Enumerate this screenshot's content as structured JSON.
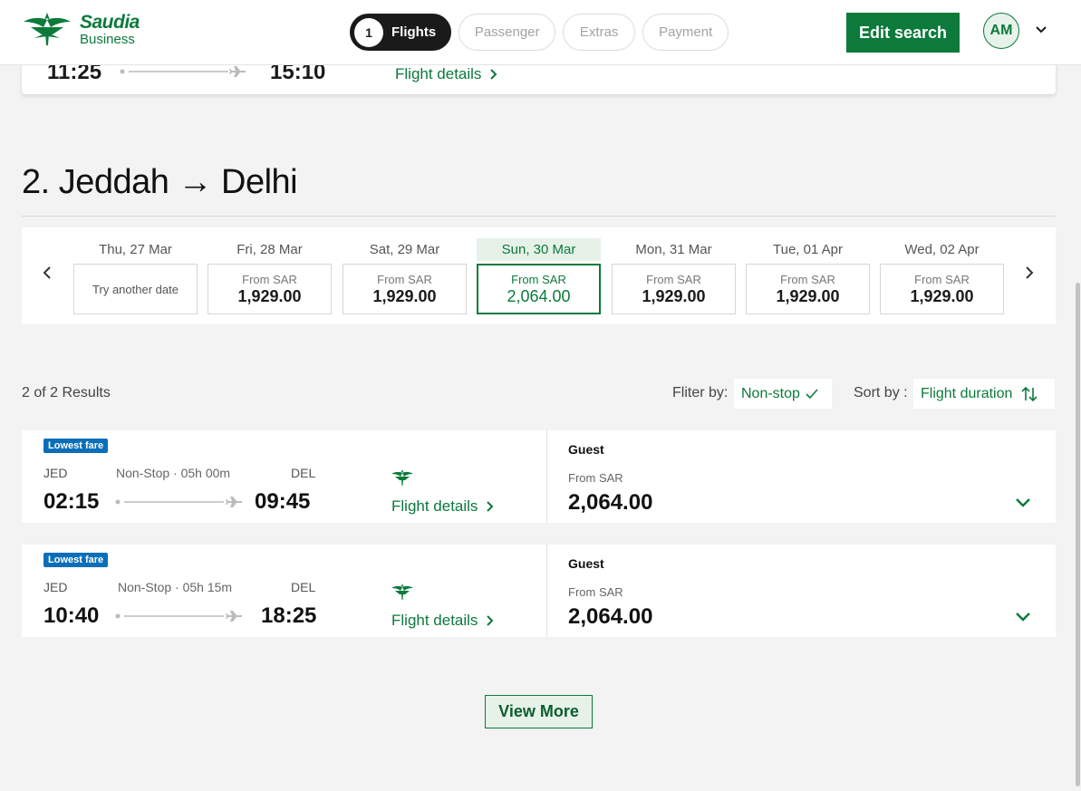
{
  "header": {
    "logo_brand": "Saudia",
    "logo_sub": "Business",
    "steps": [
      {
        "num": "1",
        "label": "Flights"
      },
      {
        "label": "Passenger"
      },
      {
        "label": "Extras"
      },
      {
        "label": "Payment"
      }
    ],
    "edit_search": "Edit search",
    "avatar_initials": "AM"
  },
  "prev_flight": {
    "depart": "11:25",
    "arrive": "15:10",
    "details": "Flight details"
  },
  "section": {
    "title": "2. Jeddah → Delhi"
  },
  "date_strip": {
    "days": [
      {
        "label": "Thu, 27 Mar",
        "other": "Try another date"
      },
      {
        "label": "Fri, 28 Mar",
        "from": "From SAR",
        "price": "1,929.00"
      },
      {
        "label": "Sat, 29 Mar",
        "from": "From SAR",
        "price": "1,929.00"
      },
      {
        "label": "Sun, 30 Mar",
        "from": "From SAR",
        "price": "2,064.00",
        "selected": true
      },
      {
        "label": "Mon, 31 Mar",
        "from": "From SAR",
        "price": "1,929.00"
      },
      {
        "label": "Tue, 01 Apr",
        "from": "From SAR",
        "price": "1,929.00"
      },
      {
        "label": "Wed, 02 Apr",
        "from": "From SAR",
        "price": "1,929.00"
      }
    ]
  },
  "results": {
    "count": "2 of 2 Results",
    "filter_label": "Fliter by:",
    "filter_value": "Non-stop",
    "sort_label": "Sort by :",
    "sort_value": "Flight duration"
  },
  "flights": [
    {
      "badge": "Lowest fare",
      "origin": "JED",
      "duration": "Non-Stop · 05h 00m",
      "destination": "DEL",
      "depart": "02:15",
      "arrive": "09:45",
      "details": "Flight details",
      "guest": "Guest",
      "from": "From SAR",
      "fare": "2,064.00"
    },
    {
      "badge": "Lowest fare",
      "origin": "JED",
      "duration": "Non-Stop · 05h 15m",
      "destination": "DEL",
      "depart": "10:40",
      "arrive": "18:25",
      "details": "Flight details",
      "guest": "Guest",
      "from": "From SAR",
      "fare": "2,064.00"
    }
  ],
  "view_more": "View More",
  "colors": {
    "brand": "#0b7a3b",
    "badge": "#0a6fb8",
    "background": "#f3f3f3"
  }
}
